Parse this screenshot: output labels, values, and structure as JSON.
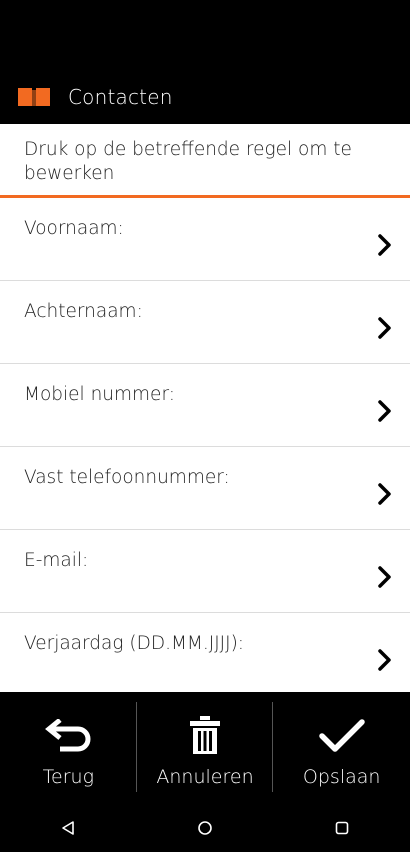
{
  "header": {
    "title": "Contacten",
    "accent_color": "#f26a21",
    "icon": "book-icon"
  },
  "hint": {
    "text": "Druk op de betreffende regel om te bewerken"
  },
  "fields": [
    {
      "label": "Voornaam:"
    },
    {
      "label": "Achternaam:"
    },
    {
      "label": "Mobiel nummer:"
    },
    {
      "label": "Vast telefoonnummer:"
    },
    {
      "label": "E-mail:"
    },
    {
      "label": "Verjaardag (DD.MM.JJJJ):"
    }
  ],
  "actions": {
    "back": {
      "label": "Terug",
      "icon": "back-arrow-icon"
    },
    "cancel": {
      "label": "Annuleren",
      "icon": "trash-icon"
    },
    "save": {
      "label": "Opslaan",
      "icon": "checkmark-icon"
    }
  },
  "navbar": {
    "icons": [
      "back-triangle-icon",
      "home-circle-icon",
      "recents-square-icon"
    ]
  }
}
